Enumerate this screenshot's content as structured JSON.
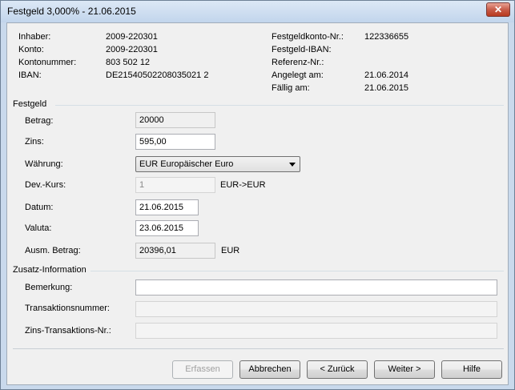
{
  "window": {
    "title": "Festgeld 3,000% - 21.06.2015",
    "close_symbol": "✕"
  },
  "info": {
    "left": [
      {
        "label": "Inhaber:",
        "value": "2009-220301"
      },
      {
        "label": "Konto:",
        "value": "2009-220301"
      },
      {
        "label": "Kontonummer:",
        "value": "803 502 12"
      },
      {
        "label": "IBAN:",
        "value": "DE21540502208035021 2"
      }
    ],
    "right": [
      {
        "label": "Festgeldkonto-Nr.:",
        "value": "122336655"
      },
      {
        "label": "Festgeld-IBAN:",
        "value": ""
      },
      {
        "label": "Referenz-Nr.:",
        "value": ""
      },
      {
        "label": "Angelegt am:",
        "value": "21.06.2014"
      },
      {
        "label": "Fällig am:",
        "value": "21.06.2015"
      }
    ]
  },
  "festgeld": {
    "group_label": "Festgeld",
    "betrag": {
      "label": "Betrag:",
      "value": "20000"
    },
    "zins": {
      "label": "Zins:",
      "value": "595,00"
    },
    "waehrung": {
      "label": "Währung:",
      "value": "EUR Europäischer Euro"
    },
    "devkurs": {
      "label": "Dev.-Kurs:",
      "value": "1",
      "suffix": "EUR->EUR"
    },
    "datum": {
      "label": "Datum:",
      "value": "21.06.2015"
    },
    "valuta": {
      "label": "Valuta:",
      "value": "23.06.2015"
    },
    "ausm_betrag": {
      "label": "Ausm. Betrag:",
      "value": "20396,01",
      "suffix": "EUR"
    }
  },
  "zusatz": {
    "group_label": "Zusatz-Information",
    "bemerkung": {
      "label": "Bemerkung:",
      "value": ""
    },
    "transaktionsnummer": {
      "label": "Transaktionsnummer:",
      "value": ""
    },
    "zins_transaktion": {
      "label": "Zins-Transaktions-Nr.:",
      "value": ""
    }
  },
  "buttons": {
    "erfassen": "Erfassen",
    "abbrechen": "Abbrechen",
    "zurueck": "< Zurück",
    "weiter": "Weiter >",
    "hilfe": "Hilfe"
  }
}
